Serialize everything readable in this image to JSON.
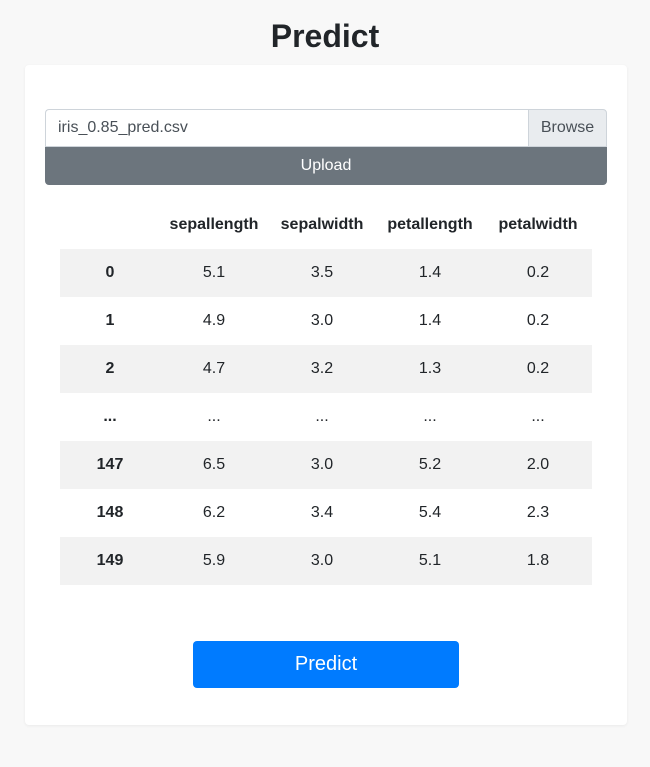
{
  "page": {
    "title": "Predict"
  },
  "upload": {
    "file_name": "iris_0.85_pred.csv",
    "browse_label": "Browse",
    "upload_label": "Upload"
  },
  "table": {
    "columns": [
      "",
      "sepallength",
      "sepalwidth",
      "petallength",
      "petalwidth"
    ],
    "rows": [
      [
        "0",
        "5.1",
        "3.5",
        "1.4",
        "0.2"
      ],
      [
        "1",
        "4.9",
        "3.0",
        "1.4",
        "0.2"
      ],
      [
        "2",
        "4.7",
        "3.2",
        "1.3",
        "0.2"
      ],
      [
        "...",
        "...",
        "...",
        "...",
        "..."
      ],
      [
        "147",
        "6.5",
        "3.0",
        "5.2",
        "2.0"
      ],
      [
        "148",
        "6.2",
        "3.4",
        "5.4",
        "2.3"
      ],
      [
        "149",
        "5.9",
        "3.0",
        "5.1",
        "1.8"
      ]
    ]
  },
  "actions": {
    "predict_label": "Predict"
  },
  "colors": {
    "primary": "#007bff",
    "secondary": "#6c757d",
    "background": "#f8f8f8",
    "stripe": "#f2f2f2"
  }
}
